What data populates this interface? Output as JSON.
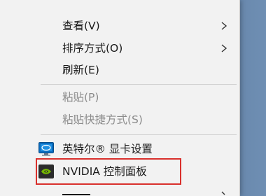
{
  "context_menu": {
    "items": [
      {
        "label": "查看(V)",
        "has_submenu": true,
        "enabled": true
      },
      {
        "label": "排序方式(O)",
        "has_submenu": true,
        "enabled": true
      },
      {
        "label": "刷新(E)",
        "has_submenu": false,
        "enabled": true
      },
      {
        "label": "粘贴(P)",
        "has_submenu": false,
        "enabled": false
      },
      {
        "label": "粘贴快捷方式(S)",
        "has_submenu": false,
        "enabled": false
      },
      {
        "label": "英特尔® 显卡设置",
        "has_submenu": false,
        "enabled": true,
        "icon": "intel-graphics-icon"
      },
      {
        "label": "NVIDIA 控制面板",
        "has_submenu": false,
        "enabled": true,
        "icon": "nvidia-icon",
        "highlighted": true
      }
    ]
  },
  "colors": {
    "highlight_border": "#d9302c",
    "menu_background": "#f2f2f2",
    "disabled_text": "#8c8c8c"
  }
}
